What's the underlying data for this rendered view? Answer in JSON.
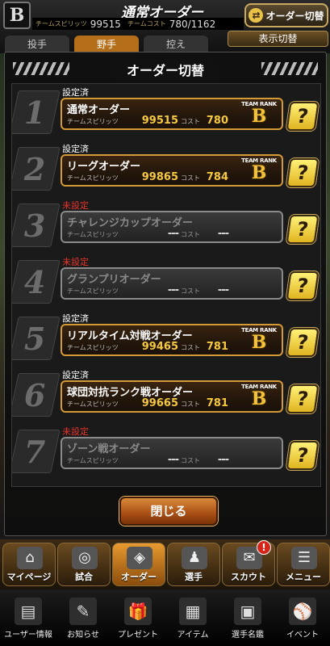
{
  "header": {
    "team_logo": "B",
    "title": "通常オーダー",
    "spirit_label": "チームスピリッツ",
    "spirit_value": "99515",
    "cost_label": "チームコスト",
    "cost_value": "780/1162",
    "order_switch_label": "オーダー切替",
    "display_switch_label": "表示切替",
    "tabs": [
      "投手",
      "野手",
      "控え"
    ]
  },
  "modal": {
    "title": "オーダー切替",
    "spirit_label": "チームスピリッツ",
    "cost_label": "コスト",
    "rank_label": "TEAM RANK",
    "help_label": "?",
    "close_label": "閉じる",
    "orders": [
      {
        "number": "1",
        "status": "設定済",
        "set": true,
        "name": "通常オーダー",
        "spirit": "99515",
        "cost": "780",
        "rank": "B"
      },
      {
        "number": "2",
        "status": "設定済",
        "set": true,
        "name": "リーグオーダー",
        "spirit": "99865",
        "cost": "784",
        "rank": "B"
      },
      {
        "number": "3",
        "status": "未設定",
        "set": false,
        "name": "チャレンジカップオーダー",
        "spirit": "---",
        "cost": "---",
        "rank": ""
      },
      {
        "number": "4",
        "status": "未設定",
        "set": false,
        "name": "グランプリオーダー",
        "spirit": "---",
        "cost": "---",
        "rank": ""
      },
      {
        "number": "5",
        "status": "設定済",
        "set": true,
        "name": "リアルタイム対戦オーダー",
        "spirit": "99465",
        "cost": "781",
        "rank": "B"
      },
      {
        "number": "6",
        "status": "設定済",
        "set": true,
        "name": "球団対抗ランク戦オーダー",
        "spirit": "99665",
        "cost": "781",
        "rank": "B"
      },
      {
        "number": "7",
        "status": "未設定",
        "set": false,
        "name": "ゾーン戦オーダー",
        "spirit": "---",
        "cost": "---",
        "rank": ""
      }
    ]
  },
  "main_menu": [
    {
      "label": "マイページ",
      "icon": "home-icon",
      "glyph": "⌂"
    },
    {
      "label": "試合",
      "icon": "stadium-icon",
      "glyph": "◎"
    },
    {
      "label": "オーダー",
      "icon": "order-icon",
      "glyph": "◈",
      "active": true
    },
    {
      "label": "選手",
      "icon": "player-icon",
      "glyph": "♟"
    },
    {
      "label": "スカウト",
      "icon": "scout-icon",
      "glyph": "✉",
      "badge": "!"
    },
    {
      "label": "メニュー",
      "icon": "menu-icon",
      "glyph": "☰"
    }
  ],
  "sub_menu": [
    {
      "label": "ユーザー情報",
      "icon": "user-info-icon",
      "glyph": "▤"
    },
    {
      "label": "お知らせ",
      "icon": "notice-icon",
      "glyph": "✎"
    },
    {
      "label": "プレゼント",
      "icon": "present-icon",
      "glyph": "🎁"
    },
    {
      "label": "アイテム",
      "icon": "item-icon",
      "glyph": "▦"
    },
    {
      "label": "選手名鑑",
      "icon": "player-book-icon",
      "glyph": "▣"
    },
    {
      "label": "イベント",
      "icon": "event-icon",
      "glyph": "⚾"
    }
  ]
}
